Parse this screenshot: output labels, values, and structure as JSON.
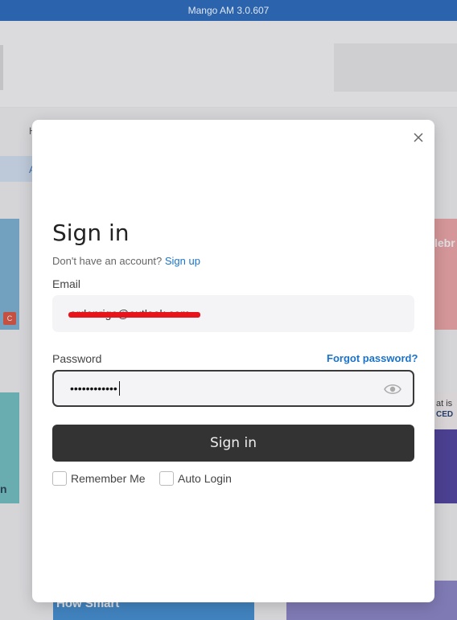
{
  "window": {
    "title": "Mango AM 3.0.607"
  },
  "background": {
    "nav_letter": "H",
    "nav_pill": "A",
    "left_card_badge": "C",
    "left_card_text": "n",
    "right_card_1_text": "lebr",
    "right_card_2_line1": "at is",
    "right_card_2_line2": "CED",
    "bottom_card_text": "How Smart"
  },
  "signin": {
    "title": "Sign in",
    "no_account_text": "Don't have an account?",
    "signup_link": "Sign up",
    "email_label": "Email",
    "email_value": "ardenrige@outlook.com",
    "password_label": "Password",
    "forgot_password": "Forgot password?",
    "password_mask": "••••••••••••",
    "signin_button": "Sign in",
    "remember_me": "Remember Me",
    "auto_login": "Auto Login"
  }
}
